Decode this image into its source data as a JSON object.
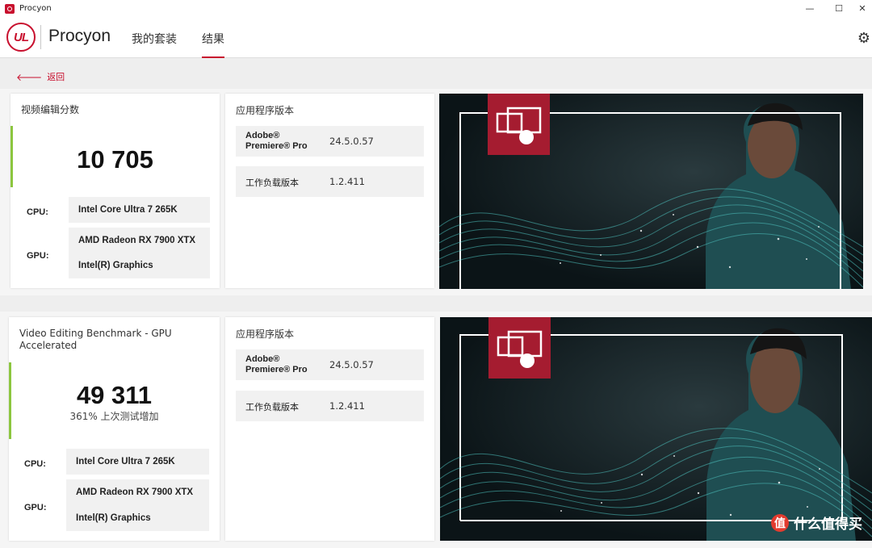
{
  "window": {
    "title": "Procyon"
  },
  "header": {
    "logo_text": "UL",
    "brand": "Procyon",
    "tabs": [
      {
        "label": "我的套装"
      },
      {
        "label": "结果"
      }
    ]
  },
  "back": {
    "label": "返回"
  },
  "results": [
    {
      "title": "视频编辑分数",
      "score": "10 705",
      "comparison": "",
      "cpu_label": "CPU:",
      "cpu": "Intel Core Ultra 7 265K",
      "gpu_label": "GPU:",
      "gpus": [
        "AMD Radeon RX 7900 XTX",
        "Intel(R) Graphics"
      ],
      "versions_title": "应用程序版本",
      "app_name_line1": "Adobe®",
      "app_name_line2": "Premiere® Pro",
      "app_version": "24.5.0.57",
      "workload_label": "工作负载版本",
      "workload_version": "1.2.411"
    },
    {
      "title": "Video Editing Benchmark - GPU Accelerated",
      "score": "49 311",
      "comparison": "361% 上次测试增加",
      "cpu_label": "CPU:",
      "cpu": "Intel Core Ultra 7 265K",
      "gpu_label": "GPU:",
      "gpus": [
        "AMD Radeon RX 7900 XTX",
        "Intel(R) Graphics"
      ],
      "versions_title": "应用程序版本",
      "app_name_line1": "Adobe®",
      "app_name_line2": "Premiere® Pro",
      "app_version": "24.5.0.57",
      "workload_label": "工作负载版本",
      "workload_version": "1.2.411"
    }
  ],
  "watermark": {
    "icon": "值",
    "text": "什么值得买"
  },
  "colors": {
    "accent": "#c8102e",
    "score_bar": "#8cc63f"
  }
}
